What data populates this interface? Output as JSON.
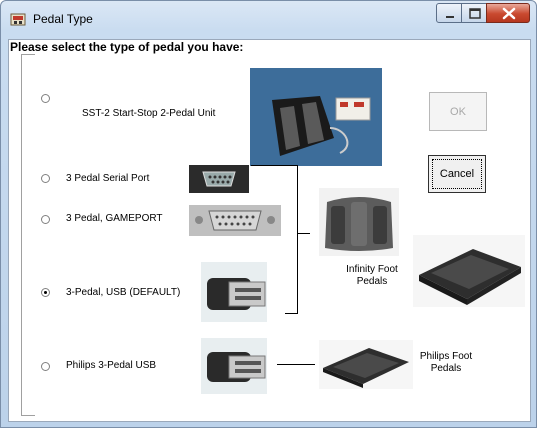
{
  "window": {
    "title": "Pedal Type"
  },
  "prompt": "Please select the type of pedal you have:",
  "options": [
    {
      "label": "SST-2 Start-Stop  2-Pedal Unit",
      "checked": false
    },
    {
      "label": "3 Pedal Serial Port",
      "checked": false
    },
    {
      "label": "3 Pedal, GAMEPORT",
      "checked": false
    },
    {
      "label": "3-Pedal, USB (DEFAULT)",
      "checked": true
    },
    {
      "label": "Philips 3-Pedal USB",
      "checked": false
    }
  ],
  "buttons": {
    "ok": "OK",
    "cancel": "Cancel"
  },
  "captions": {
    "infinity": "Infinity Foot\nPedals",
    "philips": "Philips Foot\nPedals"
  },
  "icons": {
    "app": "pedal-app-icon",
    "sst2": "sst2-pedal-unit-photo",
    "serial": "serial-port-connector-photo",
    "gameport": "gameport-connector-photo",
    "usb": "usb-connector-photo",
    "infinity": "infinity-foot-pedal-photo",
    "philips": "philips-foot-pedal-photo"
  }
}
